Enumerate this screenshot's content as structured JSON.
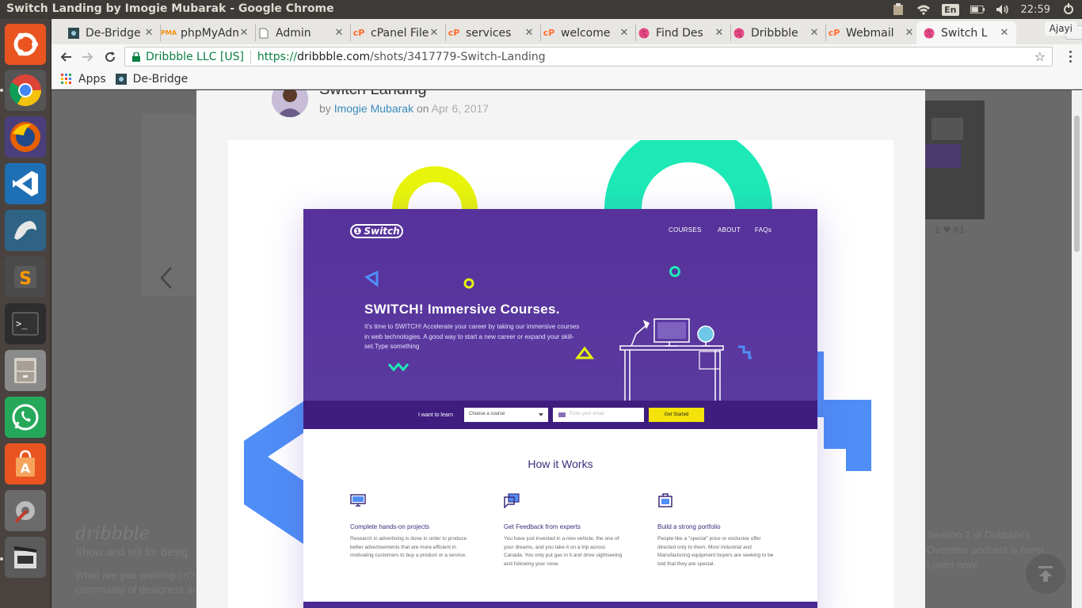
{
  "window": {
    "title": "Switch Landing by Imogie Mubarak - Google Chrome"
  },
  "panel": {
    "lang": "En",
    "time": "22:59",
    "user": "Ajayi"
  },
  "tabs": [
    {
      "label": "De-Bridge",
      "favicon": "debridge-icon",
      "favicon_color": "#2e4a52"
    },
    {
      "label": "phpMyAdmin",
      "favicon": "pma-icon",
      "favicon_color": "#f29111"
    },
    {
      "label": "Admin",
      "favicon": "page-icon",
      "favicon_color": "#777777"
    },
    {
      "label": "cPanel File",
      "favicon": "cpanel-icon",
      "favicon_color": "#ff6c2c"
    },
    {
      "label": "services",
      "favicon": "cpanel-icon",
      "favicon_color": "#ff6c2c"
    },
    {
      "label": "welcome",
      "favicon": "cpanel-icon",
      "favicon_color": "#ff6c2c"
    },
    {
      "label": "Find Des",
      "favicon": "dribbble-icon",
      "favicon_color": "#ea4c89"
    },
    {
      "label": "Dribbble",
      "favicon": "dribbble-icon",
      "favicon_color": "#ea4c89"
    },
    {
      "label": "Webmail",
      "favicon": "cpanel-icon",
      "favicon_color": "#ff6c2c"
    },
    {
      "label": "Switch L",
      "favicon": "dribbble-icon",
      "favicon_color": "#ea4c89",
      "active": true
    }
  ],
  "address": {
    "org": "Dribbble LLC [US]",
    "url_scheme": "https://",
    "url_host": "dribbble.com",
    "url_path": "/shots/3417779-Switch-Landing"
  },
  "bookmarks": {
    "apps": "Apps",
    "debridge": "De-Bridge"
  },
  "shot": {
    "title": "Switch Landing",
    "by": "by",
    "author": "Imogie Mubarak",
    "on": "on",
    "date": "Apr 6, 2017"
  },
  "mock": {
    "logo": "Switch",
    "nav": [
      "COURSES",
      "ABOUT",
      "FAQs"
    ],
    "hero_title": "SWITCH! Immersive Courses.",
    "hero_desc": "It's time to SWITCH! Accelerate your career by taking our immersive courses in web technologies. A good way to start a new career or expand your skill-set.Type something",
    "form_label": "I want to learn",
    "select_value": "Choose a course",
    "email_placeholder": "Enter your email",
    "cta": "Get Started",
    "how_title": "How it Works",
    "features": [
      {
        "title": "Complete hands-on projects",
        "text": "Research in advertising is done in order to produce better advertisements that are more efficient in motivating customers to buy a product or a service."
      },
      {
        "title": "Get Feedback from experts",
        "text": "You have just invested in a new vehicle, the one of your dreams, and you take it on a trip across Canada. You only put gas in it and drive sightseeing and following your nose."
      },
      {
        "title": "Build a strong portfolio",
        "text": "People like a \"special\" price or exclusive offer directed only to them. Most Industrial and Manufacturing equipment buyers are seeking to be told that they are special."
      }
    ]
  },
  "background": {
    "brand": "dribbble",
    "tagline": "Show and tell for desig",
    "text1": "What are you working on?",
    "text2": "community of designers an",
    "right_text": "Season 2 of Dribbble's Overtime podcast is here! Listen now!",
    "side_stats": "1   ♥ 61"
  },
  "colors": {
    "hero_purple": "#56329a",
    "form_purple": "#3f1d7f",
    "accent_yellow": "#f4e20a",
    "accent_teal": "#1de9b6",
    "accent_blue": "#4f8ef7"
  }
}
